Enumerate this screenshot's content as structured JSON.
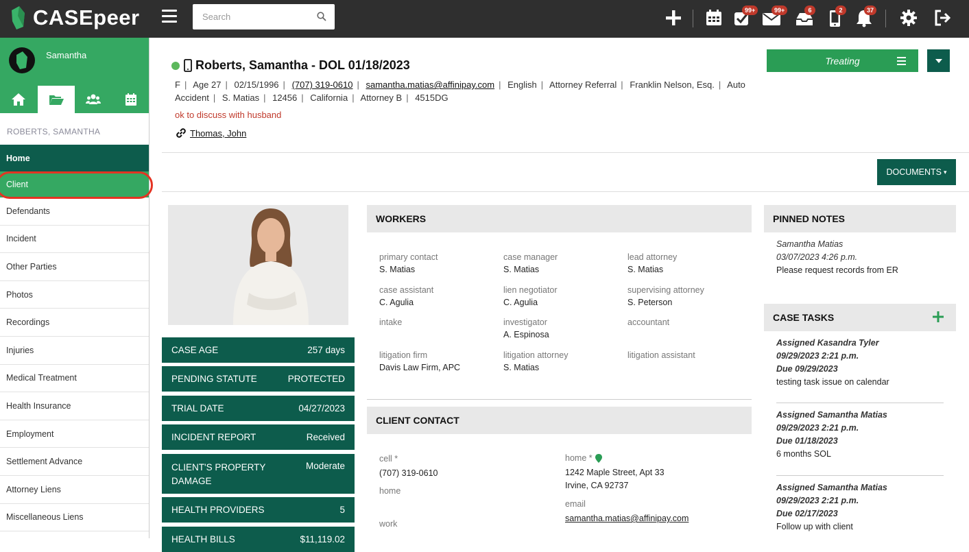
{
  "app": {
    "logo_text": "CASEpeer"
  },
  "search": {
    "placeholder": "Search"
  },
  "topbar": {
    "badges": {
      "tasks": "99+",
      "mail": "99+",
      "inbox": "6",
      "mobile": "2",
      "notifications": "37"
    }
  },
  "sidebar": {
    "user_name": "Samantha",
    "client_heading": "ROBERTS, SAMANTHA",
    "items": [
      "Home",
      "Client",
      "Defendants",
      "Incident",
      "Other Parties",
      "Photos",
      "Recordings",
      "Injuries",
      "Medical Treatment",
      "Health Insurance",
      "Employment",
      "Settlement Advance",
      "Attorney Liens",
      "Miscellaneous Liens"
    ]
  },
  "header": {
    "title": "Roberts, Samantha - DOL 01/18/2023",
    "line1": {
      "sex": "F",
      "age": "Age 27",
      "dob": "02/15/1996",
      "phone": "(707) 319-0610",
      "email": "samantha.matias@affinipay.com",
      "language": "English",
      "referral": "Attorney Referral",
      "referrer": "Franklin Nelson, Esq.",
      "case_type_a": "Auto"
    },
    "line2": {
      "case_type_b": "Accident",
      "worker": "S. Matias",
      "zip": "12456",
      "state": "California",
      "attorney": "Attorney B",
      "case_no": "4515DG"
    },
    "note": "ok to discuss with husband",
    "related_contact": "Thomas, John",
    "status_button": "Treating",
    "documents_button": "DOCUMENTS"
  },
  "stats": [
    {
      "label": "CASE AGE",
      "value": "257 days"
    },
    {
      "label": "PENDING STATUTE",
      "value": "PROTECTED"
    },
    {
      "label": "TRIAL DATE",
      "value": "04/27/2023"
    },
    {
      "label": "INCIDENT REPORT",
      "value": "Received"
    },
    {
      "label": "CLIENT'S PROPERTY DAMAGE",
      "value": "Moderate"
    },
    {
      "label": "HEALTH PROVIDERS",
      "value": "5"
    },
    {
      "label": "HEALTH BILLS",
      "value": "$11,119.02"
    }
  ],
  "workers": {
    "title": "WORKERS",
    "cells": [
      {
        "k": "primary contact",
        "v": "S. Matias"
      },
      {
        "k": "case manager",
        "v": "S. Matias"
      },
      {
        "k": "lead attorney",
        "v": "S. Matias"
      },
      {
        "k": "case assistant",
        "v": "C. Agulia"
      },
      {
        "k": "lien negotiator",
        "v": "C. Agulia"
      },
      {
        "k": "supervising attorney",
        "v": "S. Peterson"
      },
      {
        "k": "intake",
        "v": ""
      },
      {
        "k": "investigator",
        "v": "A. Espinosa"
      },
      {
        "k": "accountant",
        "v": ""
      },
      {
        "k": "litigation firm",
        "v": "Davis Law Firm, APC"
      },
      {
        "k": "litigation attorney",
        "v": "S. Matias"
      },
      {
        "k": "litigation assistant",
        "v": ""
      }
    ]
  },
  "client_contact": {
    "title": "CLIENT CONTACT",
    "cell_label": "cell *",
    "cell_value": "(707) 319-0610",
    "home_phone_label": "home",
    "work_label": "work",
    "home_addr_label": "home *",
    "addr1": "1242 Maple Street, Apt 33",
    "addr2": "Irvine, CA 92737",
    "email_label": "email",
    "email_value": "samantha.matias@affinipay.com"
  },
  "pinned_notes": {
    "title": "PINNED NOTES",
    "author": "Samantha Matias",
    "datetime": "03/07/2023 4:26 p.m.",
    "text": "Please request records from ER"
  },
  "case_tasks": {
    "title": "CASE TASKS",
    "tasks": [
      {
        "assigned": "Assigned Kasandra Tyler",
        "datetime": "09/29/2023 2:21 p.m.",
        "due": "Due 09/29/2023",
        "text": "testing task issue on calendar"
      },
      {
        "assigned": "Assigned Samantha Matias",
        "datetime": "09/29/2023 2:21 p.m.",
        "due": "Due 01/18/2023",
        "text": "6 months SOL"
      },
      {
        "assigned": "Assigned Samantha Matias",
        "datetime": "09/29/2023 2:21 p.m.",
        "due": "Due 02/17/2023",
        "text": "Follow up with client"
      }
    ]
  },
  "colors": {
    "brand_green": "#35a862",
    "dark_teal": "#0d5c4c",
    "alert_red": "#c0392b"
  }
}
